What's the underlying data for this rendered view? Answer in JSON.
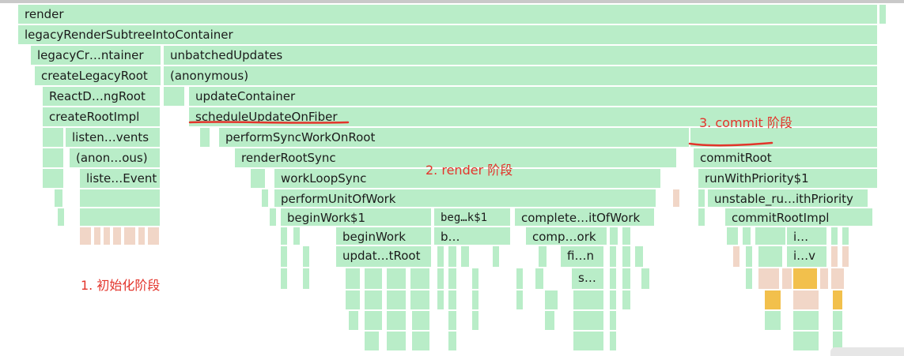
{
  "frames": {
    "render": "render",
    "legacy_render_subtree": "legacyRenderSubtreeIntoContainer",
    "legacy_container": "legacyCr…ntainer",
    "unbatched_updates": "unbatchedUpdates",
    "create_legacy_root": "createLegacyRoot",
    "anonymous": "(anonymous)",
    "react_dom_root": "ReactD…ngRoot",
    "update_container": "updateContainer",
    "create_root_impl": "createRootImpl",
    "schedule_update": "scheduleUpdateOnFiber",
    "listen_events": "listen…vents",
    "perform_sync_work": "performSyncWorkOnRoot",
    "anon_ous": "(anon…ous)",
    "render_root_sync": "renderRootSync",
    "commit_root": "commitRoot",
    "listen_event": "liste…Event",
    "work_loop_sync": "workLoopSync",
    "run_with_priority": "runWithPriority$1",
    "perform_unit_of_work": "performUnitOfWork",
    "unstable_run": "unstable_ru…ithPriority",
    "begin_work_1": "beginWork$1",
    "beg_k1": "beg…k$1",
    "complete_of_work": "complete…itOfWork",
    "commit_root_impl": "commitRootImpl",
    "begin_work": "beginWork",
    "b_dots": "b…",
    "comp_ork": "comp…ork",
    "i_dots": "i…",
    "update_root": "updat…tRoot",
    "fi_n": "fi…n",
    "i_v": "i…v",
    "s_dots": "s…"
  },
  "annotations": {
    "init_phase": "1. 初始化阶段",
    "render_phase": "2. render 阶段",
    "commit_phase": "3. commit 阶段"
  },
  "colors": {
    "frame": "#b9edc8",
    "frame_warm": "#f1d6c7",
    "frame_hot": "#f2c04c",
    "annotation": "#e3342b"
  }
}
